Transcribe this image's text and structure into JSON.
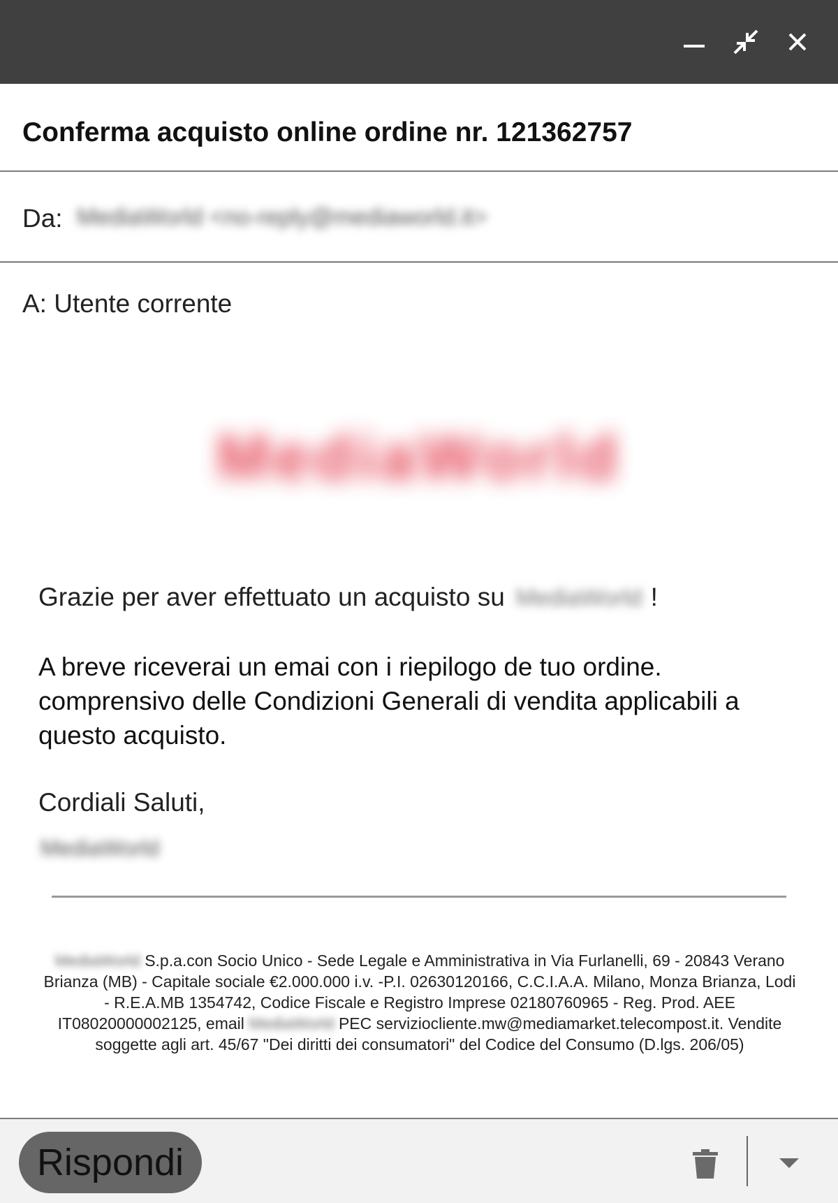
{
  "window": {
    "controls": {
      "minimize_icon": "minimize-icon",
      "shrink_icon": "shrink-icon",
      "close_icon": "close-icon"
    }
  },
  "email": {
    "subject": "Conferma acquisto online ordine nr. 121362757",
    "from_label": "Da:",
    "from_value": "MediaWorld <no-reply@mediaworld.it>",
    "to_line": "A: Utente corrente",
    "logo_text": "MediaWorld",
    "thanks_prefix": "Grazie per aver effettuato un acquisto su",
    "store_name": "MediaWorld",
    "thanks_suffix": "!",
    "message": "A breve riceverai un emai con i riepilogo de tuo ordine. comprensivo delle Condizioni Generali di vendita applicabili a questo acquisto.",
    "closing": "Cordiali Saluti,",
    "signature": "MediaWorld",
    "legal": {
      "company": "MediaWorld",
      "text1": "S.p.a.con Socio Unico - Sede Legale e Amministrativa in Via Furlanelli, 69 - 20843 Verano Brianza (MB) - Capitale sociale €2.000.000 i.v. -P.I. 02630120166, C.C.I.A.A. Milano, Monza Brianza, Lodi - R.E.A.MB 1354742, Codice Fiscale e Registro Imprese 02180760965 - Reg. Prod. AEE IT08020000002125, email",
      "email": "MediaWorld",
      "text2": "PEC serviziocliente.mw@mediamarket.telecompost.it. Vendite soggette agli art. 45/67 \"Dei diritti dei consumatori\" del Codice del Consumo (D.lgs. 206/05)"
    }
  },
  "footer": {
    "reply_label": "Rispondi",
    "trash_icon": "trash-icon",
    "more_icon": "chevron-down-icon"
  }
}
